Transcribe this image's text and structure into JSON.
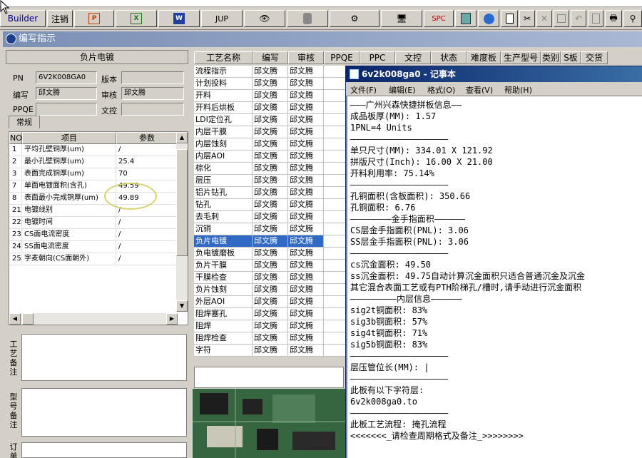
{
  "toolbar": {
    "builder_label": "Builder",
    "cancel_label": "注销",
    "jup_label": "JUP",
    "spc_label": "SPC",
    "icons": [
      "powerpoint-icon",
      "excel-icon",
      "word-icon",
      "jup-icon",
      "eye-icon",
      "database-icon",
      "network-icon",
      "computer-icon",
      "spc-icon",
      "calculator-icon",
      "globe-icon",
      "new-document-icon",
      "cut-icon",
      "delete-icon",
      "save-icon",
      "undo-icon",
      "preview-icon",
      "print-icon",
      "binoculars-icon"
    ]
  },
  "child_window": {
    "title": "编写指示"
  },
  "left_panel": {
    "section_title": "负片电镀",
    "pn_label": "PN",
    "pn_value": "6V2K008GA0",
    "version_label": "版本",
    "version_value": "",
    "author_label": "编写",
    "author_value": "邱文腾",
    "reviewer_label": "审核",
    "reviewer_value": "邱文腾",
    "ppqe_label": "PPQE",
    "ppqe_value": "",
    "doc_label": "文控",
    "doc_value": "",
    "tab_label": "常规",
    "table": {
      "headers": [
        "NO",
        "项目",
        "参数"
      ],
      "rows": [
        [
          "1",
          "平均孔壁铜厚(um)",
          "/"
        ],
        [
          "2",
          "最小孔壁铜厚(um)",
          "25.4"
        ],
        [
          "3",
          "表面完成铜厚(um)",
          "70"
        ],
        [
          "7",
          "单面电镀面积(含孔)",
          "49.59"
        ],
        [
          "8",
          "表面最小完成铜厚(um)",
          "49.89"
        ],
        [
          "21",
          "电镀线别",
          "/"
        ],
        [
          "22",
          "电镀时间",
          "/"
        ],
        [
          "23",
          "CS面电流密度",
          "/"
        ],
        [
          "24",
          "SS面电流密度",
          "/"
        ],
        [
          "25",
          "字麦朝向(CS面朝外)",
          "/"
        ]
      ]
    },
    "memo_labels": [
      "工艺备注",
      "型号备注",
      "订单"
    ]
  },
  "grid": {
    "headers": [
      "工艺名称",
      "编写",
      "审核",
      "PPQE",
      "PPC",
      "文控",
      "状态",
      "难度板",
      "生产型号",
      "类别",
      "S板",
      "交货"
    ],
    "rows": [
      [
        "流程指示",
        "邱文腾",
        "邱文腾"
      ],
      [
        "计划投料",
        "邱文腾",
        "邱文腾"
      ],
      [
        "开料",
        "邱文腾",
        "邱文腾"
      ],
      [
        "开料后烘板",
        "邱文腾",
        "邱文腾"
      ],
      [
        "LDI定位孔",
        "邱文腾",
        "邱文腾"
      ],
      [
        "内层干膜",
        "邱文腾",
        "邱文腾"
      ],
      [
        "内层蚀刻",
        "邱文腾",
        "邱文腾"
      ],
      [
        "内层AOI",
        "邱文腾",
        "邱文腾"
      ],
      [
        "棕化",
        "邱文腾",
        "邱文腾"
      ],
      [
        "层压",
        "邱文腾",
        "邱文腾"
      ],
      [
        "铝片钻孔",
        "邱文腾",
        "邱文腾"
      ],
      [
        "钻孔",
        "邱文腾",
        "邱文腾"
      ],
      [
        "去毛刺",
        "邱文腾",
        "邱文腾"
      ],
      [
        "沉铜",
        "邱文腾",
        "邱文腾"
      ],
      [
        "负片电镀",
        "邱文腾",
        "邱文腾"
      ],
      [
        "负电镀磨板",
        "邱文腾",
        "邱文腾"
      ],
      [
        "负片干膜",
        "邱文腾",
        "邱文腾"
      ],
      [
        "干膜检查",
        "邱文腾",
        "邱文腾"
      ],
      [
        "负片蚀刻",
        "邱文腾",
        "邱文腾"
      ],
      [
        "外层AOI",
        "邱文腾",
        "邱文腾"
      ],
      [
        "阻焊塞孔",
        "邱文腾",
        "邱文腾"
      ],
      [
        "阻焊",
        "邱文腾",
        "邱文腾"
      ],
      [
        "阻焊检查",
        "邱文腾",
        "邱文腾"
      ],
      [
        "字符",
        "邱文腾",
        "邱文腾"
      ]
    ],
    "selected_index": 14
  },
  "notepad": {
    "title": "6v2k008ga0 - 记事本",
    "menu": [
      "文件(F)",
      "编辑(E)",
      "格式(O)",
      "查看(V)",
      "帮助(H)"
    ],
    "lines": [
      "———广州兴森快捷拼板信息——",
      "成品板厚(MM): 1.57",
      "1PNL=4 Units",
      "———————————————————",
      "单只尺寸(MM): 334.01 X 121.92",
      "拼版尺寸(Inch): 16.00 X 21.00",
      "开料利用率: 75.14%",
      "———————————————————",
      "孔铜面积(含板面积): 350.66",
      "孔铜面积: 6.76",
      "————————金手指面积——————",
      "CS层金手指面积(PNL): 3.06",
      "SS层金手指面积(PNL): 3.06",
      "———————————————————",
      "cs沉金面积: 49.50",
      "ss沉金面积: 49.75自动计算沉金面积只适合普通沉金及沉金",
      "其它混合表面工艺或有PTH阶梯孔/槽时,请手动进行沉金面积",
      "—————————内层信息——————",
      "sig2t铜面积: 83%",
      "sig3b铜面积: 57%",
      "sig4t铜面积: 71%",
      "sig5b铜面积: 83%",
      "———————————————————",
      "层压管位长(MM): |",
      "———————————————————",
      "此板有以下字符层:",
      "6v2k008ga0.to",
      "———————————————————",
      "此板工艺流程: 掩孔流程",
      "<<<<<<<_请检查周期格式及备注_>>>>>>>>"
    ]
  }
}
